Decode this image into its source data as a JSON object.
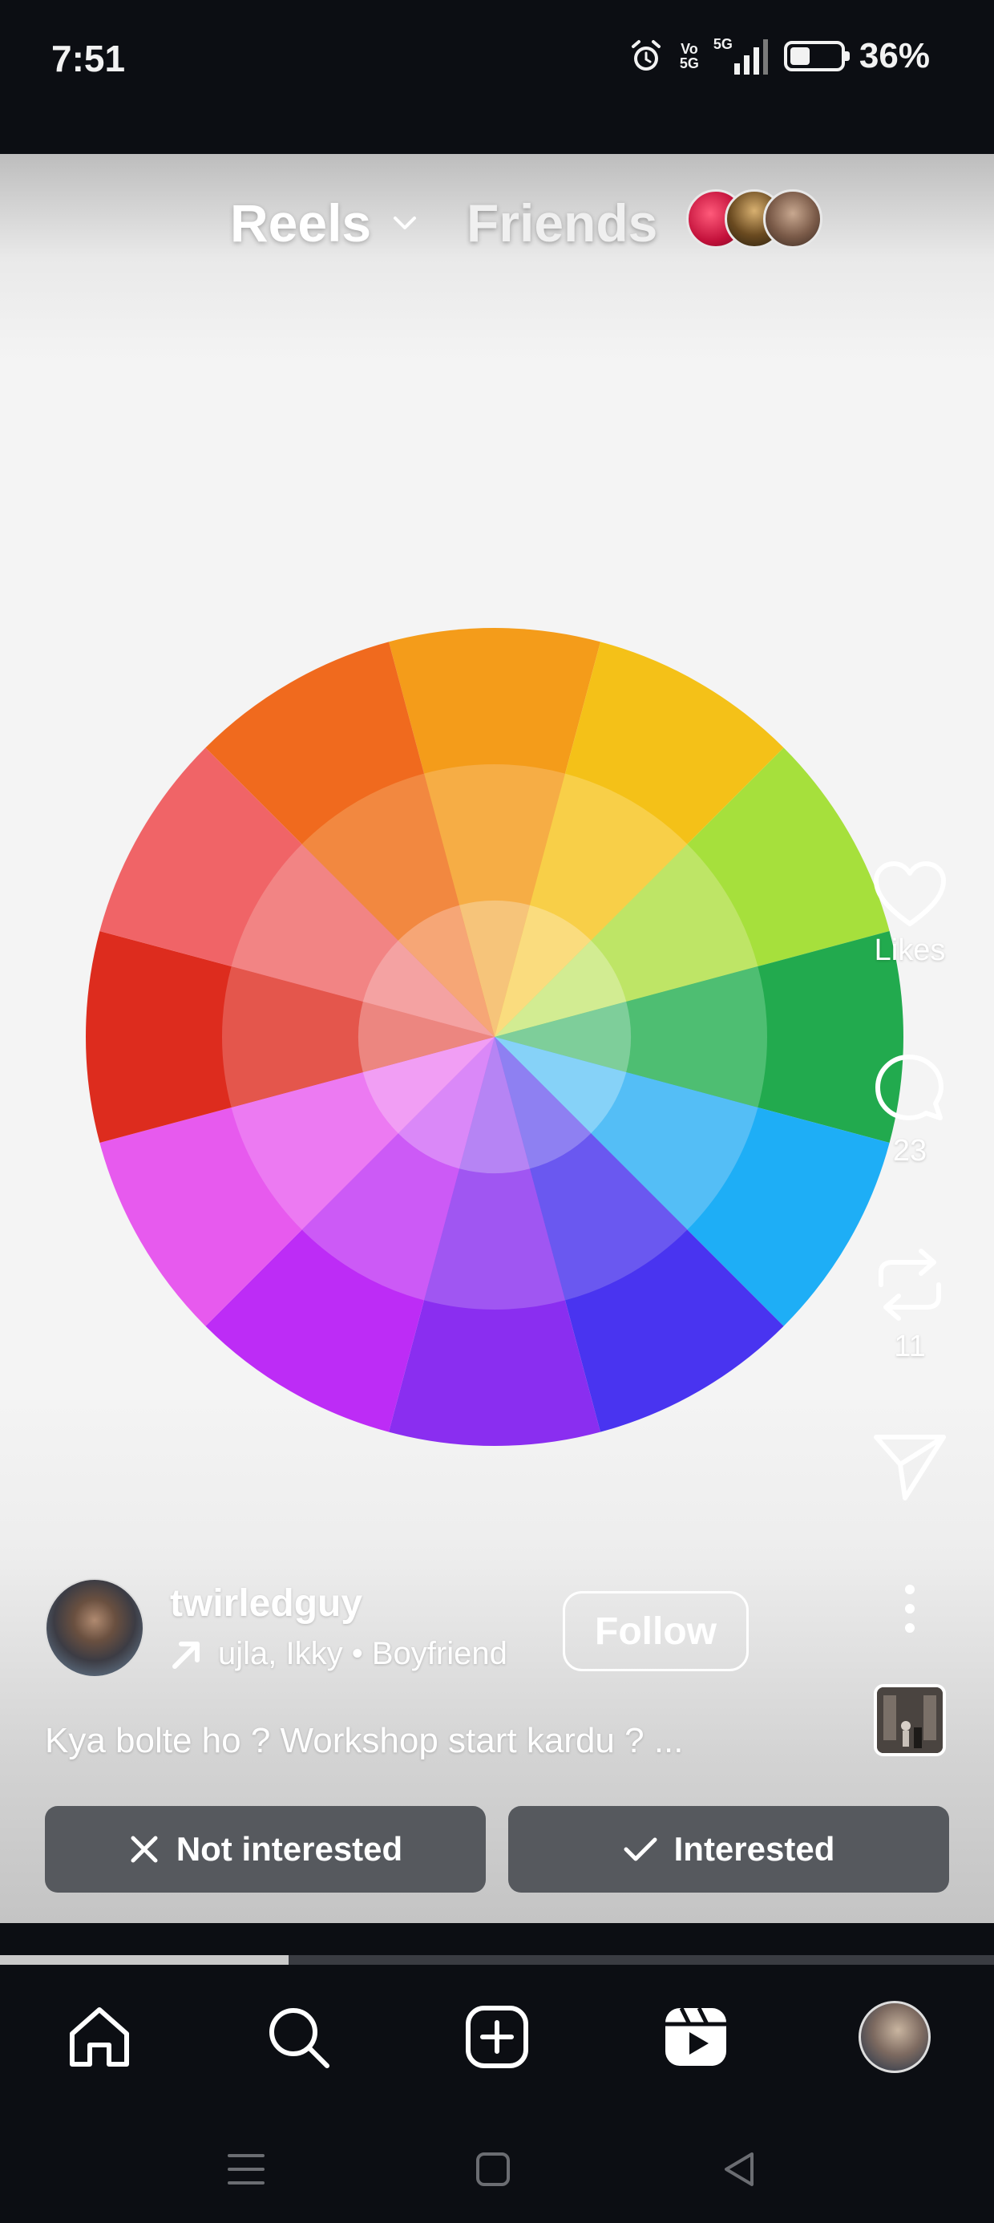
{
  "status_bar": {
    "time": "7:51",
    "volte": "Vo\n5G",
    "network": "5G",
    "battery_percent": "36%",
    "battery_level": 0.36
  },
  "header": {
    "tab_reels": "Reels",
    "tab_friends": "Friends"
  },
  "actions": {
    "likes_label": "Likes",
    "comments_count": "23",
    "reposts_count": "11"
  },
  "author": {
    "username": "twirledguy",
    "audio_line": "ujla, Ikky • Boyfriend",
    "follow_label": "Follow"
  },
  "caption": "Kya bolte ho ? Workshop start kardu ? ...",
  "feedback": {
    "not_interested": "Not interested",
    "interested": "Interested"
  },
  "playback_progress": 0.29,
  "colors": {
    "wheel_outer": [
      "#F49C1A",
      "#F4C118",
      "#A6E03C",
      "#22AA4E",
      "#1EAEF6",
      "#4934F0",
      "#8A2EF0",
      "#BD2CF6",
      "#E75AEE",
      "#DD2C1E",
      "#F06467",
      "#F06A1E"
    ],
    "wheel_middle": [
      "#F6AD45",
      "#F8CF48",
      "#BEE566",
      "#4EBE72",
      "#54BEF6",
      "#6A58F0",
      "#A056F2",
      "#CC5AF6",
      "#EC7AF2",
      "#E4564C",
      "#F28484",
      "#F28840"
    ],
    "wheel_inner": [
      "#F6C47A",
      "#FADC7E",
      "#D2EC92",
      "#7ECE9A",
      "#86D2F8",
      "#8E80F2",
      "#B684F4",
      "#DA88F8",
      "#F19EF4",
      "#EC8680",
      "#F4A2A2",
      "#F6A676"
    ]
  }
}
